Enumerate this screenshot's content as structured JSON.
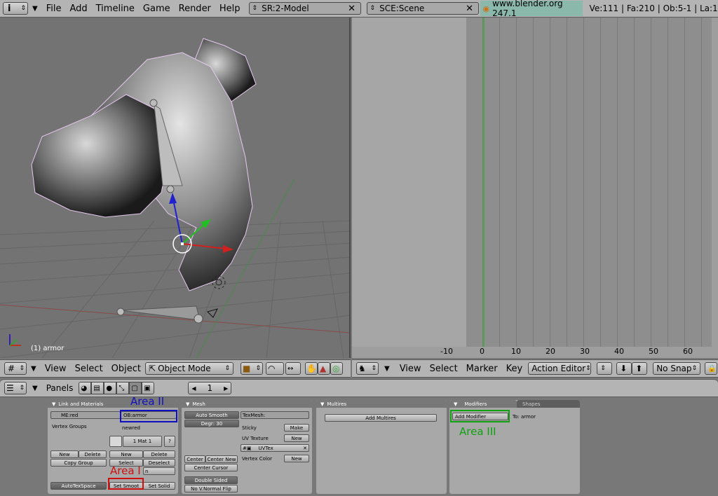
{
  "top": {
    "menus": [
      "File",
      "Add",
      "Timeline",
      "Game",
      "Render",
      "Help"
    ],
    "screen": "SR:2-Model",
    "scene": "SCE:Scene",
    "url": "www.blender.org 247.1",
    "stats": "Ve:111 | Fa:210 | Ob:5-1 | La:1"
  },
  "viewport": {
    "object_label": "(1) armor",
    "menus": [
      "View",
      "Select",
      "Object"
    ],
    "mode": "Object Mode"
  },
  "action": {
    "ticks": [
      "-10",
      "0",
      "10",
      "20",
      "30",
      "40",
      "50",
      "60"
    ],
    "menus": [
      "View",
      "Select",
      "Marker",
      "Key"
    ],
    "editor": "Action Editor",
    "snap": "No Snap"
  },
  "buttons": {
    "panels_label": "Panels",
    "frame": "1",
    "link": {
      "title": "Link and Materials",
      "me": "ME:red",
      "ob": "OB:armor",
      "vgroups": "Vertex Groups",
      "mat_name": "newred",
      "mat_idx": "1 Mat 1",
      "mat_q": "?",
      "new": "New",
      "delete": "Delete",
      "copy_group": "Copy Group",
      "new2": "New",
      "delete2": "Delete",
      "select": "Select",
      "deselect": "Deselect",
      "assign": "n",
      "autotex": "AutoTexSpace",
      "set_smooth": "Set Smoot",
      "set_solid": "Set Solid"
    },
    "mesh": {
      "title": "Mesh",
      "auto_smooth": "Auto Smooth",
      "degr": "Degr: 30",
      "texmesh": "TexMesh:",
      "sticky": "Sticky",
      "make": "Make",
      "uvtex_label": "UV Texture",
      "new": "New",
      "uvtex": "UVTex",
      "vcol": "Vertex Color",
      "new2": "New",
      "center": "Center",
      "center_new": "Center New",
      "center_cursor": "Center Cursor",
      "double_sided": "Double Sided",
      "no_vnormal": "No V.Normal Flip"
    },
    "multires": {
      "title": "Multires",
      "add": "Add Multires"
    },
    "modifiers": {
      "title": "Modifiers",
      "shapes": "Shapes",
      "add": "Add Modifier",
      "to": "To: armor"
    }
  },
  "annotations": {
    "area1": "Area I",
    "area2": "Area II",
    "area3": "Area III"
  },
  "colors": {
    "area1": "#cc1010",
    "area2": "#1010c0",
    "area3": "#10a010",
    "timeline_marker": "#4aa84a"
  }
}
